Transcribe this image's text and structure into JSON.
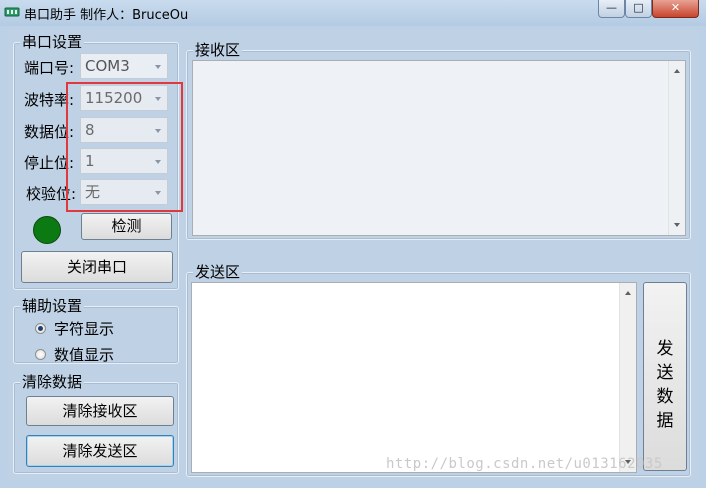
{
  "window": {
    "title": "串口助手  制作人：BruceOu",
    "min_label": "—",
    "max_label": "□",
    "close_label": "✕"
  },
  "serial": {
    "legend": "串口设置",
    "port_label": "端口号:",
    "port_value": "COM3",
    "baud_label": "波特率:",
    "baud_value": "115200",
    "data_label": "数据位:",
    "data_value": "8",
    "stop_label": "停止位:",
    "stop_value": "1",
    "parity_label": "校验位:",
    "parity_value": "无",
    "detect_button": "检测",
    "close_port_button": "关闭串口",
    "led_color": "#0b7a12"
  },
  "receive": {
    "legend": "接收区"
  },
  "send": {
    "legend": "发送区",
    "send_button_chars": [
      "发",
      "送",
      "数",
      "据"
    ]
  },
  "assist": {
    "legend": "辅助设置",
    "opt_char": "字符显示",
    "opt_num": "数值显示",
    "selected": "字符显示"
  },
  "clear": {
    "legend": "清除数据",
    "clear_receive": "清除接收区",
    "clear_send": "清除发送区"
  },
  "watermark": "http://blog.csdn.net/u013162035",
  "highlight_color": "#e0383c"
}
